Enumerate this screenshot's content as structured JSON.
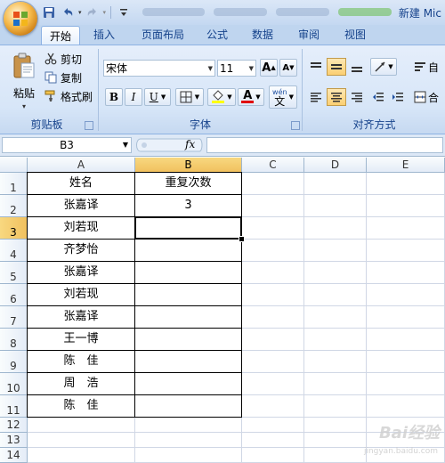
{
  "window": {
    "title": "新建 Mic",
    "quick_access": [
      "save-icon",
      "undo-icon",
      "redo-icon",
      "customize-icon"
    ]
  },
  "tabs": [
    "开始",
    "插入",
    "页面布局",
    "公式",
    "数据",
    "审阅",
    "视图"
  ],
  "active_tab": "开始",
  "ribbon": {
    "clipboard": {
      "caption": "剪贴板",
      "paste": "粘贴",
      "cut": "剪切",
      "copy": "复制",
      "format_painter": "格式刷"
    },
    "font": {
      "caption": "字体",
      "font_name": "宋体",
      "font_size": "11",
      "grow": "A",
      "shrink": "A",
      "bold": "B",
      "italic": "I",
      "underline": "U",
      "font_color_letter": "A",
      "phonetic": "wén",
      "phonetic_char": "文"
    },
    "alignment": {
      "caption": "对齐方式",
      "wrap_text": "自",
      "merge": "合"
    }
  },
  "formula_bar": {
    "name_box": "B3",
    "fx": "fx",
    "content": ""
  },
  "grid": {
    "columns": [
      "A",
      "B",
      "C",
      "D",
      "E"
    ],
    "rows": [
      "1",
      "2",
      "3",
      "4",
      "5",
      "6",
      "7",
      "8",
      "9",
      "10",
      "11",
      "12",
      "13",
      "14"
    ],
    "selected_column": "B",
    "selected_row": "3",
    "active_cell": "B3",
    "cells": {
      "A1": "姓名",
      "B1": "重复次数",
      "A2": "张嘉译",
      "B2": "3",
      "A3": "刘若现",
      "A4": "齐梦怡",
      "A5": "张嘉译",
      "A6": "刘若现",
      "A7": "张嘉译",
      "A8": "王一博",
      "A9": "陈　佳",
      "A10": "周　浩",
      "A11": "陈　佳"
    }
  },
  "watermark": {
    "logo": "Bai经验",
    "url": "jingyan.baidu.com"
  },
  "colors": {
    "ribbon_bg": "#d7e6f8",
    "tab_text": "#15428b",
    "selected_header": "#f1c15f",
    "grid_line": "#d0d7e5"
  }
}
